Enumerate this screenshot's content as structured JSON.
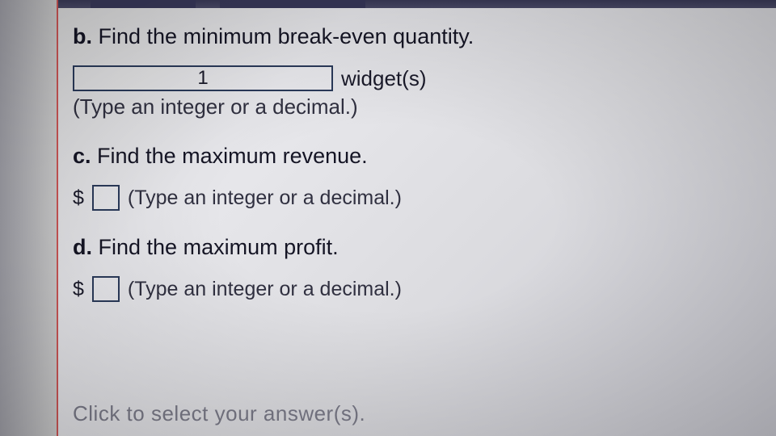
{
  "questions": {
    "b": {
      "letter": "b.",
      "prompt": "Find the minimum break-even quantity.",
      "value": "1",
      "unit": "widget(s)",
      "hint": "(Type an integer or a decimal.)"
    },
    "c": {
      "letter": "c.",
      "prompt": "Find the maximum revenue.",
      "currency": "$",
      "value": "",
      "hint": "(Type an integer or a decimal.)"
    },
    "d": {
      "letter": "d.",
      "prompt": "Find the maximum profit.",
      "currency": "$",
      "value": "",
      "hint": "(Type an integer or a decimal.)"
    }
  },
  "footer_instruction": "Click to select your answer(s)."
}
